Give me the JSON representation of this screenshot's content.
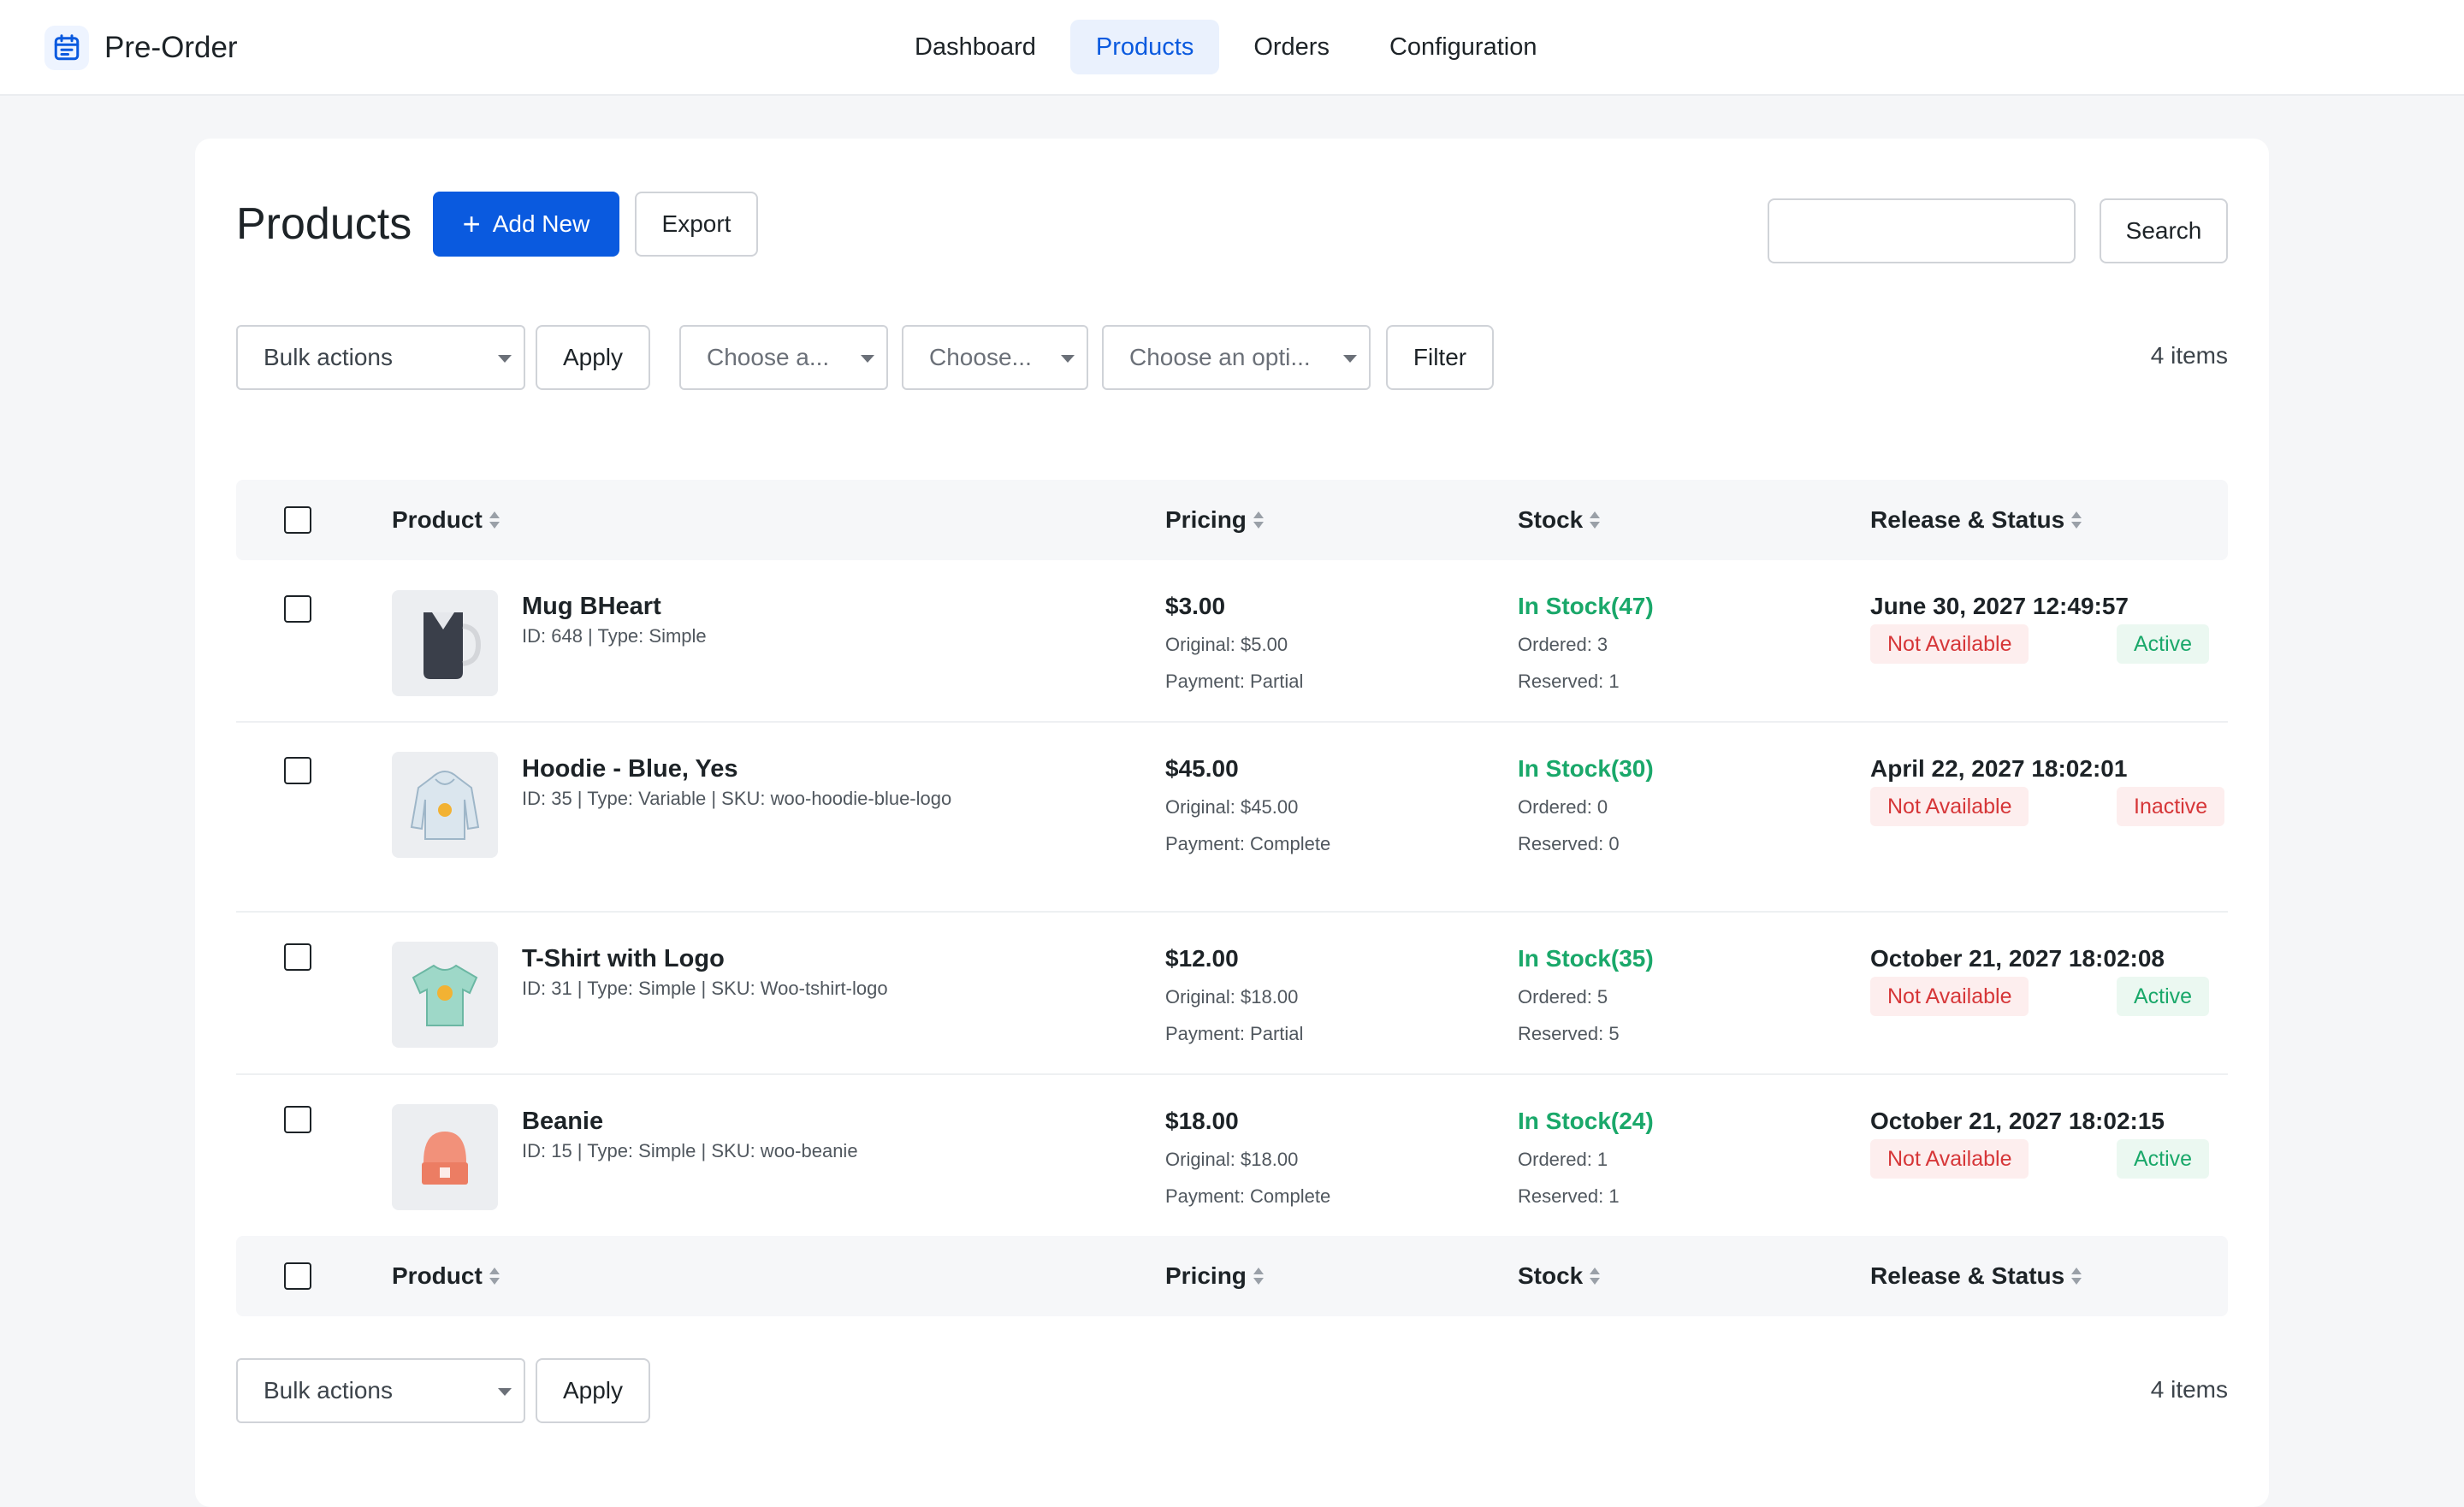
{
  "app": {
    "title": "Pre-Order"
  },
  "nav": {
    "items": [
      {
        "label": "Dashboard"
      },
      {
        "label": "Products",
        "active": true
      },
      {
        "label": "Orders"
      },
      {
        "label": "Configuration"
      }
    ]
  },
  "header": {
    "title": "Products",
    "add_new_label": "Add New",
    "export_label": "Export",
    "search_value": "",
    "search_button_label": "Search"
  },
  "filters": {
    "bulk_actions": "Bulk actions",
    "apply_label": "Apply",
    "select1": "Choose a...",
    "select2": "Choose...",
    "select3": "Choose an opti...",
    "filter_label": "Filter",
    "item_count": "4 items"
  },
  "table": {
    "columns": {
      "product": "Product",
      "pricing": "Pricing",
      "stock": "Stock",
      "release": "Release & Status"
    },
    "rows": [
      {
        "name": "Mug BHeart",
        "meta": "ID: 648 | Type: Simple",
        "thumb_icon": "mug-icon",
        "price": "$3.00",
        "original": "Original: $5.00",
        "payment": "Payment: Partial",
        "stock": "In Stock(47)",
        "ordered": "Ordered: 3",
        "reserved": "Reserved: 1",
        "release": "June 30, 2027 12:49:57",
        "availability": "Not Available",
        "status": "Active"
      },
      {
        "name": "Hoodie - Blue, Yes",
        "meta": "ID: 35 | Type: Variable | SKU: woo-hoodie-blue-logo",
        "thumb_icon": "hoodie-icon",
        "price": "$45.00",
        "original": "Original: $45.00",
        "payment": "Payment: Complete",
        "stock": "In Stock(30)",
        "ordered": "Ordered: 0",
        "reserved": "Reserved: 0",
        "release": "April 22, 2027 18:02:01",
        "availability": "Not Available",
        "status": "Inactive"
      },
      {
        "name": "T-Shirt with Logo",
        "meta": "ID: 31 | Type: Simple | SKU: Woo-tshirt-logo",
        "thumb_icon": "tshirt-icon",
        "price": "$12.00",
        "original": "Original: $18.00",
        "payment": "Payment: Partial",
        "stock": "In Stock(35)",
        "ordered": "Ordered: 5",
        "reserved": "Reserved: 5",
        "release": "October 21, 2027 18:02:08",
        "availability": "Not Available",
        "status": "Active"
      },
      {
        "name": "Beanie",
        "meta": "ID: 15 | Type: Simple | SKU: woo-beanie",
        "thumb_icon": "beanie-icon",
        "price": "$18.00",
        "original": "Original: $18.00",
        "payment": "Payment: Complete",
        "stock": "In Stock(24)",
        "ordered": "Ordered: 1",
        "reserved": "Reserved: 1",
        "release": "October 21, 2027 18:02:15",
        "availability": "Not Available",
        "status": "Active"
      }
    ]
  },
  "footer": {
    "bulk_actions": "Bulk actions",
    "apply_label": "Apply",
    "item_count": "4 items"
  },
  "colors": {
    "primary": "#0a5adf",
    "success": "#1aa86a",
    "danger": "#d63638"
  }
}
